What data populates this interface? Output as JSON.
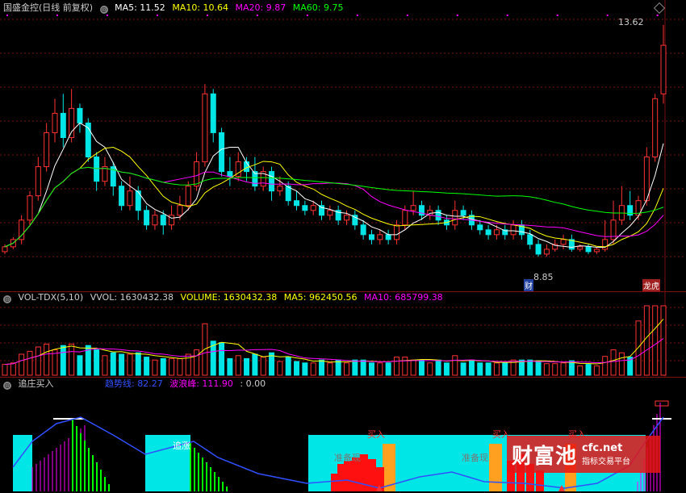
{
  "main_header": {
    "title": "国盛金控(日线 前复权)",
    "ma5": "MA5: 11.52",
    "ma10": "MA10: 10.64",
    "ma20": "MA20: 9.87",
    "ma60": "MA60: 9.75"
  },
  "vol_header": {
    "title": "VOL-TDX(5,10)",
    "vvol": "VVOL: 1630432.38",
    "volume": "VOLUME: 1630432.38",
    "ma5": "MA5: 962450.56",
    "ma10": "MA10: 685799.38"
  },
  "ind_header": {
    "title": "追庄买入",
    "trend": "趋势线: 82.27",
    "wave": "波浪峰: 111.90",
    "extra": ": 0.00"
  },
  "labels": {
    "high": "13.62",
    "low": "8.85",
    "cai": "财",
    "longhu": "龙虎",
    "zhuizhang": "追涨",
    "zhunbei1": "准备现",
    "zhunbei2": "准备现",
    "buy1": "买入",
    "buy2": "买入",
    "buy3": "买入"
  },
  "watermark": {
    "name": "财富池",
    "url": "cfc.net",
    "tagline": "指标交易平台"
  },
  "colors": {
    "up": "#ff3232",
    "down": "#00e6e6",
    "ma5": "#ffffff",
    "ma10": "#ffff00",
    "ma20": "#ff00ff",
    "ma60": "#00ff00",
    "grid": "#7a1010"
  },
  "chart_data": {
    "type": "candlestick",
    "y_range": [
      8.4,
      13.9
    ],
    "highest": 13.62,
    "lowest": 8.85,
    "candles": [
      [
        8.95,
        9.05,
        8.9,
        9.1
      ],
      [
        9.05,
        9.2,
        9.0,
        9.25
      ],
      [
        9.2,
        9.6,
        9.1,
        9.7
      ],
      [
        9.6,
        10.1,
        9.5,
        10.2
      ],
      [
        10.1,
        10.7,
        10.0,
        10.9
      ],
      [
        10.7,
        11.4,
        10.6,
        11.6
      ],
      [
        11.4,
        11.8,
        11.2,
        12.1
      ],
      [
        11.8,
        11.3,
        11.1,
        12.2
      ],
      [
        11.3,
        11.9,
        11.2,
        12.3
      ],
      [
        11.9,
        11.6,
        11.4,
        12.0
      ],
      [
        11.6,
        10.9,
        10.8,
        11.7
      ],
      [
        10.9,
        10.4,
        10.2,
        11.0
      ],
      [
        10.4,
        10.7,
        10.3,
        10.9
      ],
      [
        10.7,
        10.3,
        10.1,
        10.8
      ],
      [
        10.3,
        9.9,
        9.8,
        10.4
      ],
      [
        9.9,
        10.2,
        9.8,
        10.5
      ],
      [
        10.2,
        9.8,
        9.6,
        10.3
      ],
      [
        9.8,
        9.5,
        9.4,
        9.9
      ],
      [
        9.5,
        9.7,
        9.4,
        9.8
      ],
      [
        9.7,
        9.5,
        9.3,
        9.8
      ],
      [
        9.5,
        9.7,
        9.4,
        9.9
      ],
      [
        9.7,
        9.9,
        9.6,
        10.1
      ],
      [
        9.9,
        10.3,
        9.8,
        10.4
      ],
      [
        10.3,
        10.8,
        10.2,
        11.0
      ],
      [
        10.8,
        12.2,
        10.7,
        12.4
      ],
      [
        12.2,
        11.4,
        11.2,
        12.3
      ],
      [
        11.4,
        10.6,
        10.5,
        11.5
      ],
      [
        10.6,
        10.5,
        10.3,
        10.9
      ],
      [
        10.5,
        10.8,
        10.4,
        11.0
      ],
      [
        10.8,
        10.6,
        10.4,
        10.9
      ],
      [
        10.6,
        10.3,
        10.2,
        10.9
      ],
      [
        10.3,
        10.6,
        10.2,
        10.7
      ],
      [
        10.6,
        10.2,
        10.0,
        10.7
      ],
      [
        10.2,
        10.3,
        10.1,
        10.5
      ],
      [
        10.3,
        10.0,
        9.9,
        10.4
      ],
      [
        10.0,
        9.9,
        9.8,
        10.2
      ],
      [
        9.9,
        9.8,
        9.7,
        10.0
      ],
      [
        9.8,
        9.9,
        9.7,
        10.0
      ],
      [
        9.9,
        9.7,
        9.6,
        10.0
      ],
      [
        9.7,
        9.8,
        9.6,
        9.9
      ],
      [
        9.8,
        9.6,
        9.5,
        9.9
      ],
      [
        9.6,
        9.7,
        9.5,
        9.8
      ],
      [
        9.7,
        9.5,
        9.4,
        9.8
      ],
      [
        9.5,
        9.3,
        9.2,
        9.6
      ],
      [
        9.3,
        9.2,
        9.1,
        9.4
      ],
      [
        9.2,
        9.3,
        9.1,
        9.4
      ],
      [
        9.3,
        9.2,
        9.1,
        9.4
      ],
      [
        9.2,
        9.5,
        9.1,
        9.6
      ],
      [
        9.5,
        9.8,
        9.4,
        9.9
      ],
      [
        9.8,
        9.9,
        9.7,
        10.2
      ],
      [
        9.9,
        9.7,
        9.6,
        10.0
      ],
      [
        9.7,
        9.8,
        9.6,
        9.9
      ],
      [
        9.8,
        9.6,
        9.5,
        9.9
      ],
      [
        9.6,
        9.5,
        9.4,
        9.7
      ],
      [
        9.5,
        9.8,
        9.4,
        10.0
      ],
      [
        9.8,
        9.7,
        9.6,
        9.9
      ],
      [
        9.7,
        9.5,
        9.4,
        9.8
      ],
      [
        9.5,
        9.4,
        9.3,
        9.6
      ],
      [
        9.4,
        9.3,
        9.2,
        9.5
      ],
      [
        9.3,
        9.4,
        9.2,
        9.5
      ],
      [
        9.4,
        9.3,
        9.2,
        9.5
      ],
      [
        9.3,
        9.5,
        9.2,
        9.6
      ],
      [
        9.5,
        9.3,
        9.2,
        9.6
      ],
      [
        9.3,
        9.1,
        9.0,
        9.4
      ],
      [
        9.1,
        8.9,
        8.85,
        9.2
      ],
      [
        8.9,
        9.0,
        8.85,
        9.1
      ],
      [
        9.0,
        9.1,
        8.95,
        9.2
      ],
      [
        9.1,
        9.2,
        9.0,
        9.3
      ],
      [
        9.2,
        9.0,
        8.95,
        9.3
      ],
      [
        9.0,
        9.05,
        8.95,
        9.1
      ],
      [
        9.05,
        8.95,
        8.9,
        9.1
      ],
      [
        8.95,
        9.0,
        8.9,
        9.05
      ],
      [
        9.0,
        9.2,
        8.95,
        9.6
      ],
      [
        9.2,
        9.6,
        9.1,
        10.0
      ],
      [
        9.6,
        9.9,
        9.5,
        10.3
      ],
      [
        9.9,
        9.7,
        9.6,
        10.2
      ],
      [
        9.7,
        10.0,
        9.6,
        10.1
      ],
      [
        10.0,
        10.9,
        9.9,
        11.1
      ],
      [
        10.9,
        12.1,
        10.8,
        12.2
      ],
      [
        12.2,
        13.2,
        12.0,
        13.62
      ]
    ]
  }
}
